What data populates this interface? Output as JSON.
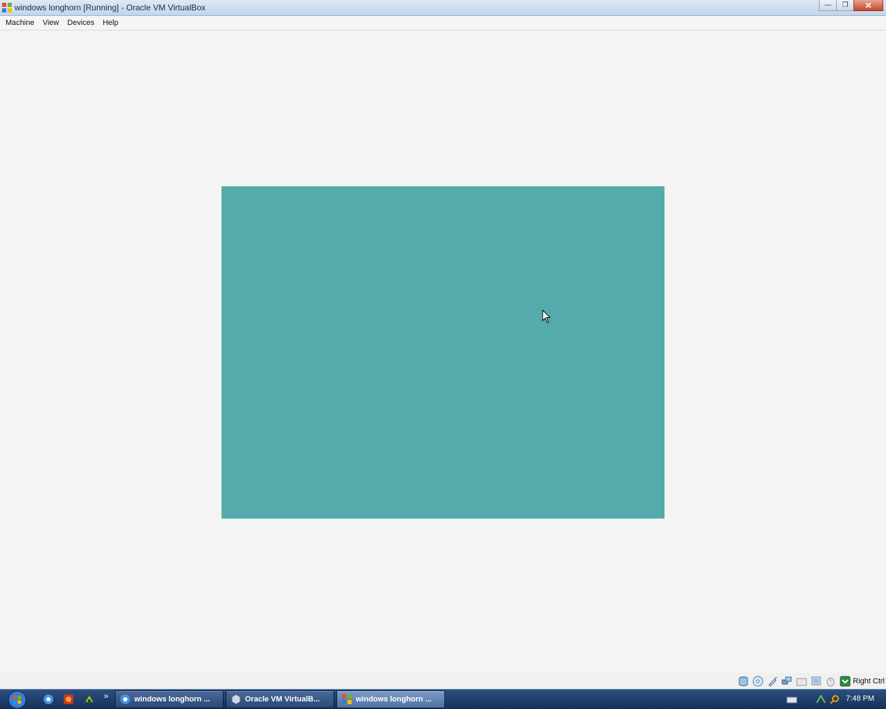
{
  "window": {
    "title": "windows longhorn [Running] - Oracle VM VirtualBox",
    "minimize": "—",
    "restore": "❐",
    "close": "✕"
  },
  "menu": [
    "Machine",
    "View",
    "Devices",
    "Help"
  ],
  "vm": {
    "screen_color": "#55abab"
  },
  "statusbar": {
    "icons": [
      "hard-disk-icon",
      "optical-drive-icon",
      "usb-icon",
      "network-icon",
      "shared-folders-icon",
      "display-icon",
      "mouse-integration-icon",
      "host-key-icon"
    ],
    "host_key_label": "Right Ctrl"
  },
  "taskbar": {
    "quick_launch": [
      "chrome-icon",
      "firefox-icon",
      "app-icon"
    ],
    "chevron": "»",
    "tasks": [
      {
        "label": "windows longhorn ...",
        "icon": "chrome-icon",
        "active": false
      },
      {
        "label": "Oracle VM VirtualB...",
        "icon": "virtualbox-icon",
        "active": false
      },
      {
        "label": "windows longhorn ...",
        "icon": "vm-window-icon",
        "active": true
      }
    ],
    "tray_icons": [
      "keyboard-icon",
      "network-tray-icon",
      "search-tray-icon"
    ],
    "clock": "7:48 PM"
  }
}
